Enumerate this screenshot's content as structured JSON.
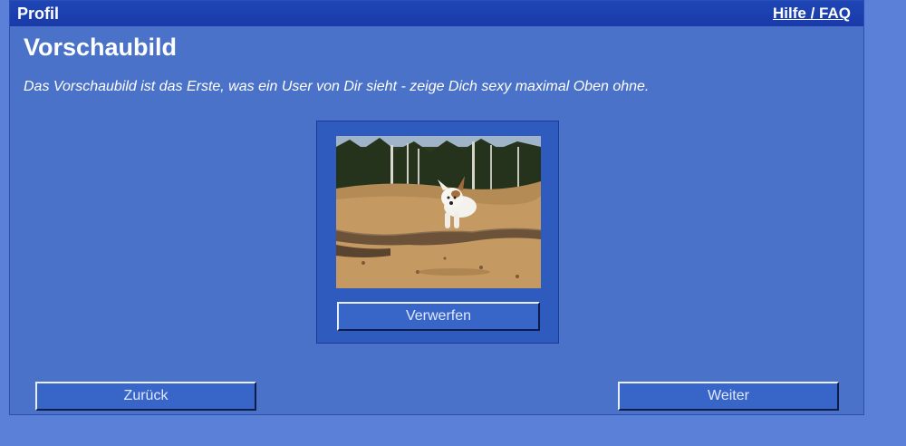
{
  "window": {
    "title": "Profil",
    "help_link": "Hilfe / FAQ"
  },
  "section": {
    "heading": "Vorschaubild",
    "description": "Das Vorschaubild ist das Erste, was ein User von Dir sieht - zeige Dich sexy maximal Oben ohne."
  },
  "preview": {
    "discard_label": "Verwerfen"
  },
  "navigation": {
    "back_label": "Zurück",
    "next_label": "Weiter"
  },
  "colors": {
    "page_background": "#5a80d8",
    "panel_background": "#4a72c8",
    "titlebar": "#1e46b6",
    "button": "#3766c8"
  }
}
